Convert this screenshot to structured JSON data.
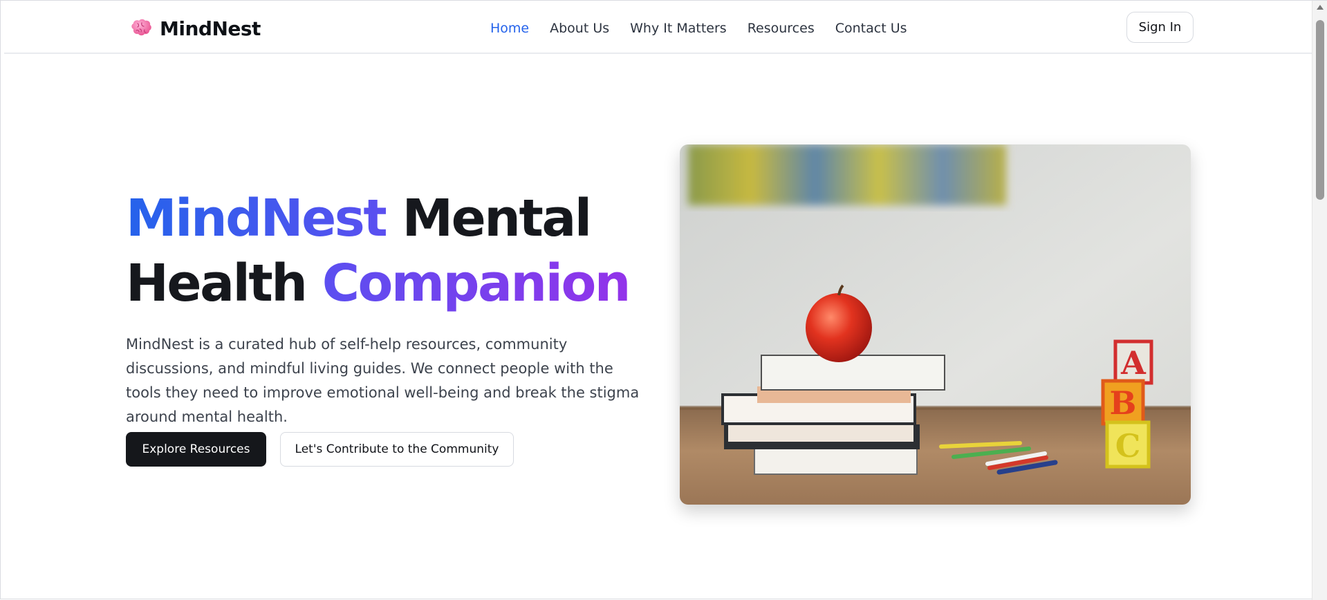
{
  "header": {
    "brand": "MindNest",
    "nav": [
      {
        "label": "Home",
        "active": true
      },
      {
        "label": "About Us",
        "active": false
      },
      {
        "label": "Why It Matters",
        "active": false
      },
      {
        "label": "Resources",
        "active": false
      },
      {
        "label": "Contact Us",
        "active": false
      }
    ],
    "sign_in_label": "Sign In",
    "brand_icon": "brain-icon"
  },
  "hero": {
    "title_part1": "MindNest",
    "title_part2": " Mental",
    "title_part3": "Health ",
    "title_part4": "Companion",
    "description": "MindNest is a curated hub of self-help resources, community discussions, and mindful living guides. We connect people with the tools they need to improve emotional well-being and break the stigma around mental health.",
    "primary_button": "Explore Resources",
    "secondary_button": "Let's Contribute to the Community",
    "image": "apple-on-books-with-abc-blocks-photo",
    "image_blocks": [
      "A",
      "B",
      "C"
    ]
  },
  "colors": {
    "accent_blue": "#2563eb",
    "accent_purple": "#9333ea",
    "primary_button_bg": "#15171b"
  }
}
